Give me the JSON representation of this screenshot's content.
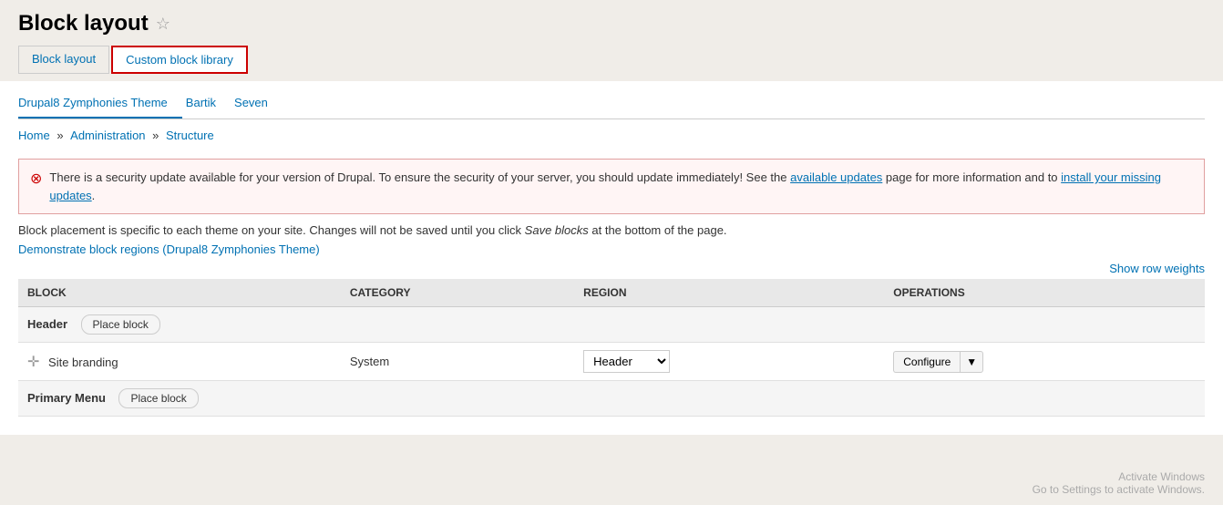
{
  "page": {
    "title": "Block layout",
    "star": "☆"
  },
  "tabs": [
    {
      "id": "block-layout",
      "label": "Block layout",
      "active": false
    },
    {
      "id": "custom-block-library",
      "label": "Custom block library",
      "active": true
    }
  ],
  "theme_tabs": [
    {
      "id": "drupal8-zymphonies",
      "label": "Drupal8 Zymphonies Theme",
      "active": true
    },
    {
      "id": "bartik",
      "label": "Bartik",
      "active": false
    },
    {
      "id": "seven",
      "label": "Seven",
      "active": false
    }
  ],
  "breadcrumb": {
    "items": [
      "Home",
      "Administration",
      "Structure"
    ],
    "separators": "»"
  },
  "alert": {
    "message_start": "There is a security update available for your version of Drupal. To ensure the security of your server, you should update immediately! See the ",
    "link1_text": "available updates",
    "message_mid": " page for more information and to ",
    "link2_text": "install your missing updates",
    "message_end": "."
  },
  "info_text": "Block placement is specific to each theme on your site. Changes will not be saved until you click Save blocks at the bottom of the page.",
  "demo_link": "Demonstrate block regions (Drupal8 Zymphonies Theme)",
  "show_row_weights": "Show row weights",
  "table": {
    "columns": [
      "BLOCK",
      "CATEGORY",
      "REGION",
      "OPERATIONS"
    ],
    "sections": [
      {
        "label": "Header",
        "place_block_label": "Place block",
        "rows": [
          {
            "block": "Site branding",
            "category": "System",
            "region": "Header",
            "operation": "Configure"
          }
        ]
      },
      {
        "label": "Primary Menu",
        "place_block_label": "Place block",
        "rows": []
      }
    ]
  },
  "watermark": {
    "line1": "Activate Windows",
    "line2": "Go to Settings to activate Windows."
  }
}
